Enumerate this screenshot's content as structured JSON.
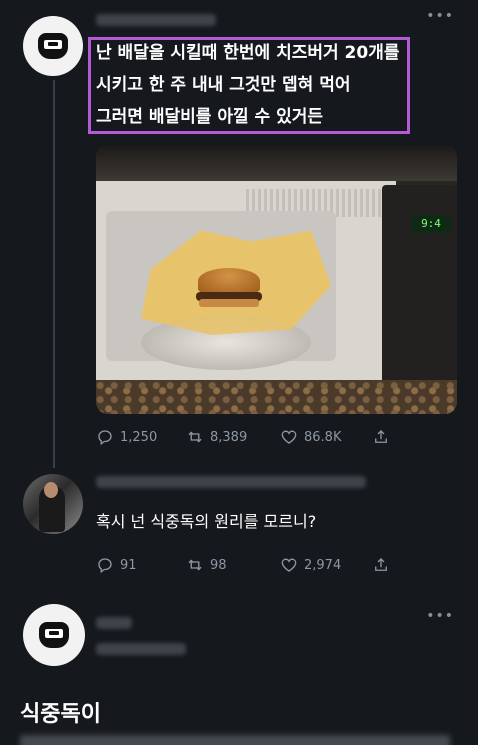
{
  "tweet1": {
    "lines": [
      "난 배달을 시킬때 한번에 치즈버거 20개를",
      "시키고 한 주 내내 그것만 뎁혀 먹어",
      "그러면 배달비를 아낄 수 있거든"
    ],
    "microwave_display": "9:4",
    "actions": {
      "replies": "1,250",
      "retweets": "8,389",
      "likes": "86.8K"
    }
  },
  "tweet2": {
    "text": "혹시 넌 식중독의 원리를 모르니?",
    "actions": {
      "replies": "91",
      "retweets": "98",
      "likes": "2,974"
    }
  },
  "tweet3": {
    "text": "식중독이"
  },
  "menu_icon": "more-dots-icon",
  "colors": {
    "highlight": "#b35bd6",
    "background": "#15181c"
  }
}
